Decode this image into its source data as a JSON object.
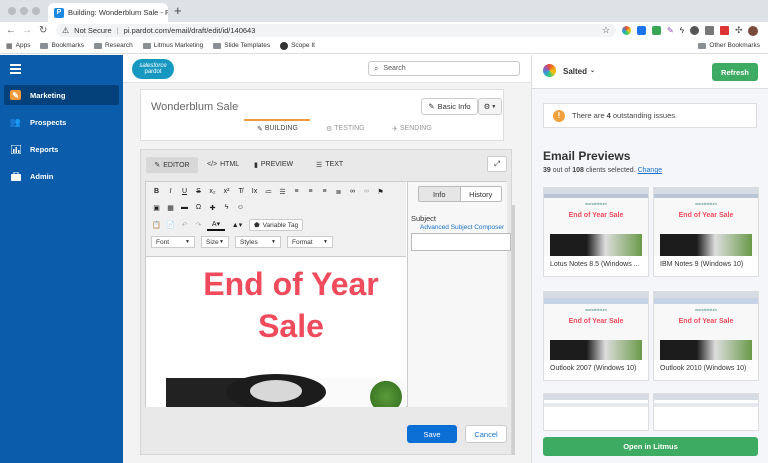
{
  "browser": {
    "tab_title": "Building: Wonderblum Sale - P...",
    "favicon_letter": "P",
    "security_label": "Not Secure",
    "url": "pi.pardot.com/email/draft/edit/id/140643",
    "bookmarks": [
      "Apps",
      "Bookmarks",
      "Research",
      "Litmus Marketing",
      "Slide Templates",
      "Scope It"
    ],
    "other_bookmarks": "Other Bookmarks"
  },
  "header": {
    "logo_top": "salesforce",
    "logo_bottom": "pardot",
    "search_placeholder": "Search"
  },
  "sidebar": {
    "items": [
      {
        "label": "Marketing"
      },
      {
        "label": "Prospects"
      },
      {
        "label": "Reports"
      },
      {
        "label": "Admin"
      }
    ]
  },
  "email": {
    "title": "Wonderblum Sale",
    "basic_info_label": "Basic Info",
    "steps": [
      "BUILDING",
      "TESTING",
      "SENDING"
    ],
    "editor_tabs": [
      "EDITOR",
      "HTML",
      "PREVIEW",
      "TEXT"
    ],
    "variable_tag": "Variable Tag",
    "selects": [
      "Font",
      "Size",
      "Styles",
      "Format"
    ],
    "headline_line1": "End of Year",
    "headline_line2": "Sale",
    "side_tabs": [
      "Info",
      "History"
    ],
    "subject_label": "Subject",
    "advanced_link": "Advanced Subject Composer",
    "save_label": "Save",
    "cancel_label": "Cancel"
  },
  "litmus": {
    "workspace": "Salted",
    "refresh_label": "Refresh",
    "issues_prefix": "There are ",
    "issues_count": "4",
    "issues_suffix": " outstanding issues.",
    "previews_title": "Email Previews",
    "clients_selected": "39",
    "clients_mid": " out of ",
    "clients_total": "108",
    "clients_suffix": " clients selected.",
    "change_link": "Change",
    "previews": [
      {
        "label": "Lotus Notes 8.5 (Windows ...",
        "brand": "wonderblum",
        "headline": "End of Year Sale"
      },
      {
        "label": "IBM Notes 9 (Windows 10)",
        "brand": "wonderblum",
        "headline": "End of Year Sale"
      },
      {
        "label": "Outlook 2007 (Windows 10)",
        "brand": "wonderblum",
        "headline": "End of Year Sale"
      },
      {
        "label": "Outlook 2010 (Windows 10)",
        "brand": "wonderblum",
        "headline": "End of Year Sale"
      }
    ],
    "open_label": "Open in Litmus"
  },
  "colors": {
    "sidebar": "#0b5cab",
    "headline": "#ef4b5c",
    "refresh": "#3dab62",
    "save": "#0a70d6",
    "warning": "#f0a13c"
  }
}
